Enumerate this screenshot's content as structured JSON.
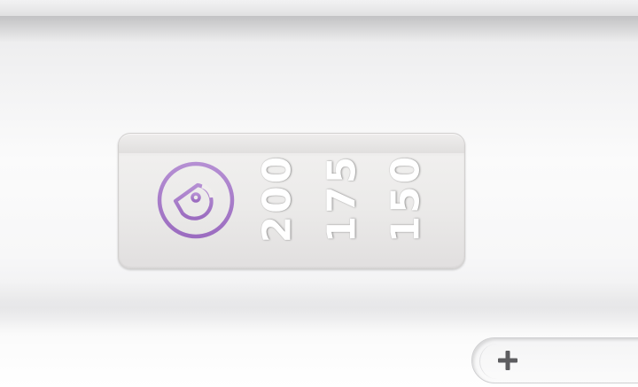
{
  "dose_panel": {
    "icon": "dispenser-droplet-icon",
    "values": [
      "200",
      "175",
      "150"
    ],
    "accent_color": "#a07cc0"
  },
  "add_button": {
    "icon": "plus-icon"
  }
}
